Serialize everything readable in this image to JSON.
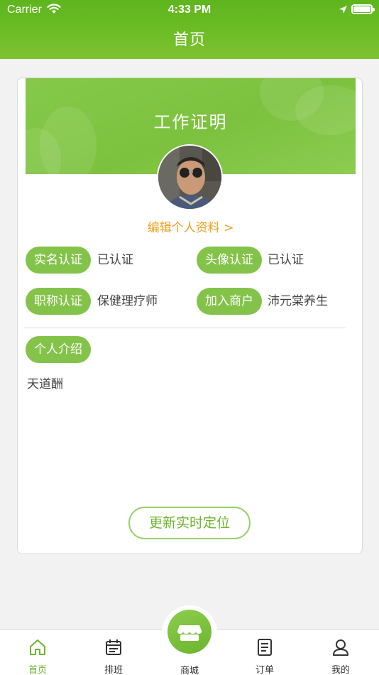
{
  "status_bar": {
    "carrier": "Carrier",
    "time": "4:33 PM"
  },
  "nav": {
    "title": "首页"
  },
  "card": {
    "banner_title": "工作证明",
    "edit_link": "编辑个人资料 >",
    "verifications": [
      {
        "label": "实名认证",
        "value": "已认证"
      },
      {
        "label": "头像认证",
        "value": "已认证"
      },
      {
        "label": "职称认证",
        "value": "保健理疗师"
      },
      {
        "label": "加入商户",
        "value": "沛元棠养生"
      }
    ],
    "intro_label": "个人介绍",
    "intro_text": "天道酬",
    "update_button": "更新实时定位"
  },
  "tabbar": {
    "items": [
      {
        "label": "首页",
        "icon": "home-icon",
        "active": true
      },
      {
        "label": "排班",
        "icon": "calendar-icon",
        "active": false
      },
      {
        "label": "商城",
        "icon": "shop-icon",
        "active": false
      },
      {
        "label": "订单",
        "icon": "order-icon",
        "active": false
      },
      {
        "label": "我的",
        "icon": "profile-icon",
        "active": false
      }
    ]
  },
  "colors": {
    "brand_green": "#6db52e",
    "badge_green": "#84c34a",
    "link_orange": "#f0a020"
  }
}
